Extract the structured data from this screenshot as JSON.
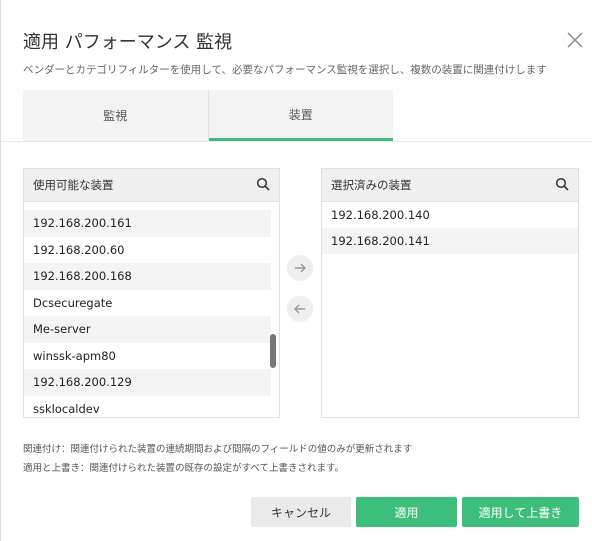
{
  "dialog": {
    "title": "適用 パフォーマンス 監視",
    "subtitle": "ベンダーとカテゴリフィルターを使用して、必要なパフォーマンス監視を選択し、複数の装置に関連付けします"
  },
  "tabs": [
    {
      "label": "監視",
      "active": false
    },
    {
      "label": "装置",
      "active": true
    }
  ],
  "available": {
    "header": "使用可能な装置",
    "items": [
      "192.168.200.161",
      "192.168.200.60",
      "192.168.200.168",
      "Dcsecuregate",
      "Me-server",
      "winssk-apm80",
      "192.168.200.129",
      "ssklocaldev"
    ]
  },
  "selected": {
    "header": "選択済みの装置",
    "items": [
      "192.168.200.140",
      "192.168.200.141"
    ]
  },
  "notes": {
    "associate": "関連付け：関連付けられた装置の連続期間および間隔のフィールドの値のみが更新されます",
    "overwrite": "適用と上書き：関連付けられた装置の既存の設定がすべて上書きされます。"
  },
  "buttons": {
    "cancel": "キャンセル",
    "apply": "適用",
    "apply_overwrite": "適用して上書き"
  },
  "colors": {
    "accent": "#3dbf7b"
  }
}
